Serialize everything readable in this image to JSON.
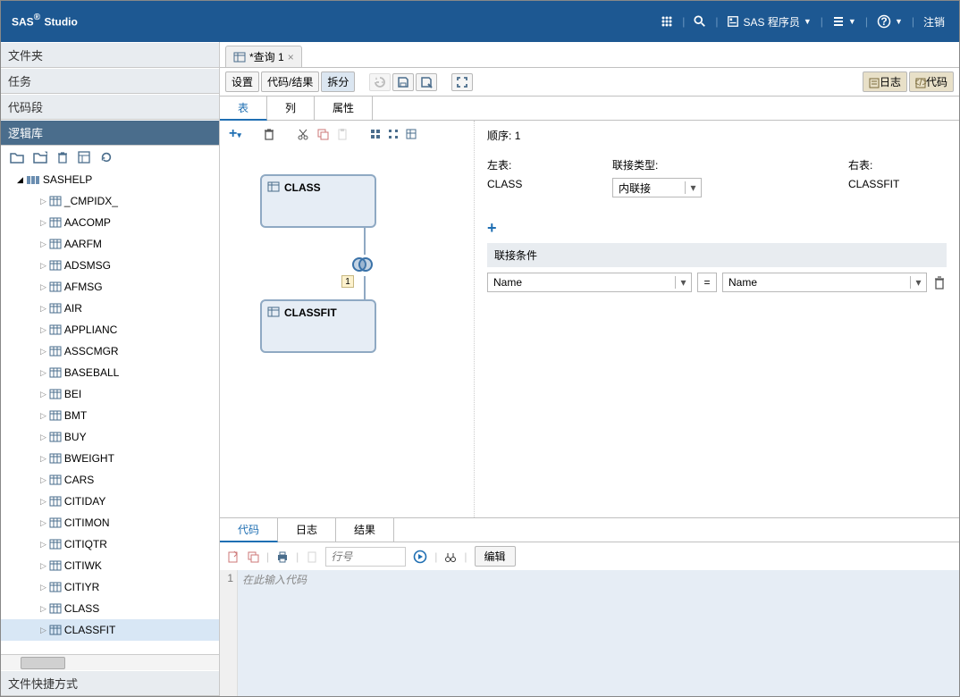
{
  "app": {
    "title_prefix": "SAS",
    "title_suffix": "Studio",
    "user": "SAS 程序员",
    "signout": "注销"
  },
  "nav": {
    "folders": "文件夹",
    "tasks": "任务",
    "snippets": "代码段",
    "libraries": "逻辑库",
    "shortcuts": "文件快捷方式"
  },
  "tree": {
    "parent": "SASHELP",
    "items": [
      "_CMPIDX_",
      "AACOMP",
      "AARFM",
      "ADSMSG",
      "AFMSG",
      "AIR",
      "APPLIANC",
      "ASSCMGR",
      "BASEBALL",
      "BEI",
      "BMT",
      "BUY",
      "BWEIGHT",
      "CARS",
      "CITIDAY",
      "CITIMON",
      "CITIQTR",
      "CITIWK",
      "CITIYR",
      "CLASS",
      "CLASSFIT"
    ],
    "selected": "CLASSFIT"
  },
  "maintab": {
    "label": "*查询 1"
  },
  "toolbar": {
    "settings": "设置",
    "coderesult": "代码/结果",
    "split": "拆分",
    "log": "日志",
    "code": "代码"
  },
  "subtabs": {
    "tables": "表",
    "columns": "列",
    "props": "属性"
  },
  "details": {
    "order_label": "顺序:",
    "order_value": "1",
    "left_table_label": "左表:",
    "left_table": "CLASS",
    "join_type_label": "联接类型:",
    "join_type": "内联接",
    "right_table_label": "右表:",
    "right_table": "CLASSFIT",
    "cond_header": "联接条件",
    "cond_left": "Name",
    "cond_op": "=",
    "cond_right": "Name"
  },
  "nodes": {
    "class": "CLASS",
    "classfit": "CLASSFIT",
    "badge": "1"
  },
  "codetabs": {
    "code": "代码",
    "log": "日志",
    "result": "结果"
  },
  "codetb": {
    "line_placeholder": "行号",
    "edit": "编辑"
  },
  "editor": {
    "line": "1",
    "placeholder": "在此输入代码"
  }
}
